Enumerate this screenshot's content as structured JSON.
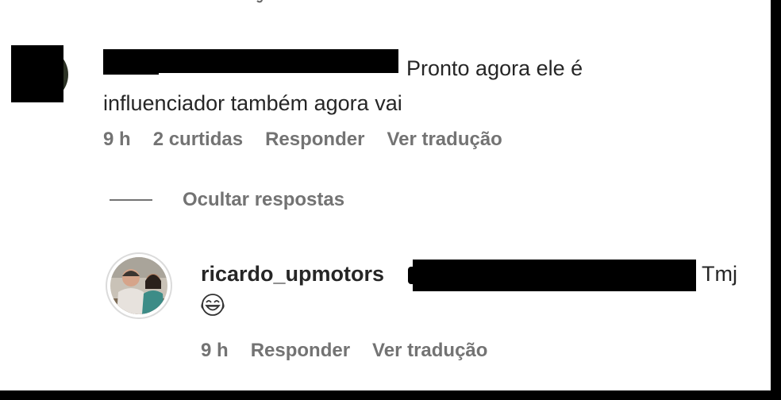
{
  "comment": {
    "text_line1": "Pronto agora ele é",
    "text_line2": "influenciador também agora vai",
    "time": "9 h",
    "likes": "2 curtidas",
    "reply_label": "Responder",
    "translate_label": "Ver tradução"
  },
  "replies_toggle": {
    "label": "Ocultar respostas"
  },
  "reply": {
    "username": "ricardo_upmotors",
    "text": "Tmj",
    "emoji": "laughing-crying-emoji",
    "time": "9 h",
    "reply_label": "Responder",
    "translate_label": "Ver tradução"
  },
  "colors": {
    "text": "#262626",
    "meta": "#737373",
    "redaction": "#000000"
  }
}
